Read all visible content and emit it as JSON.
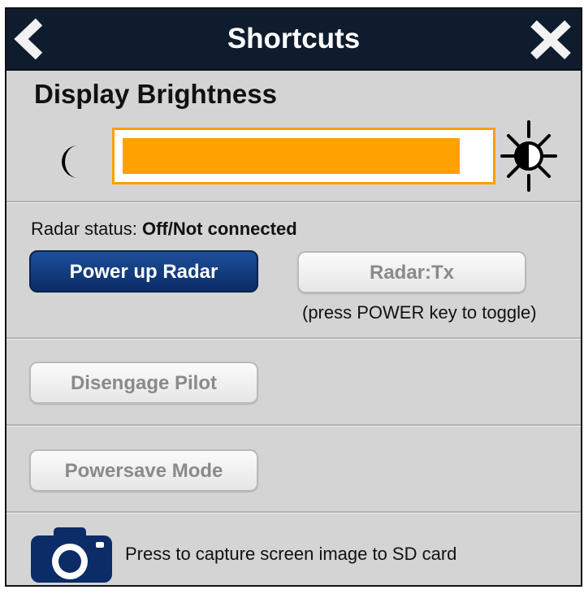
{
  "header": {
    "title": "Shortcuts",
    "back_icon": "chevron-left-icon",
    "close_icon": "close-icon"
  },
  "brightness": {
    "title": "Display Brightness",
    "level_percent": 93,
    "min_icon": "moon-icon",
    "max_icon": "sun-icon",
    "fill_color": "#ffa100"
  },
  "radar": {
    "status_label": "Radar status:",
    "status_value": "Off/Not connected",
    "power_button": "Power up Radar",
    "tx_button": "Radar:Tx",
    "hint": "(press POWER key to toggle)"
  },
  "pilot": {
    "disengage_button": "Disengage Pilot"
  },
  "power": {
    "powersave_button": "Powersave Mode"
  },
  "capture": {
    "icon": "camera-icon",
    "text": "Press to capture screen image to SD card"
  },
  "colors": {
    "header_bg": "#0f1c2e",
    "panel_bg": "#d4d4d4",
    "primary_button": "#0b2c66",
    "accent": "#ffa100"
  }
}
